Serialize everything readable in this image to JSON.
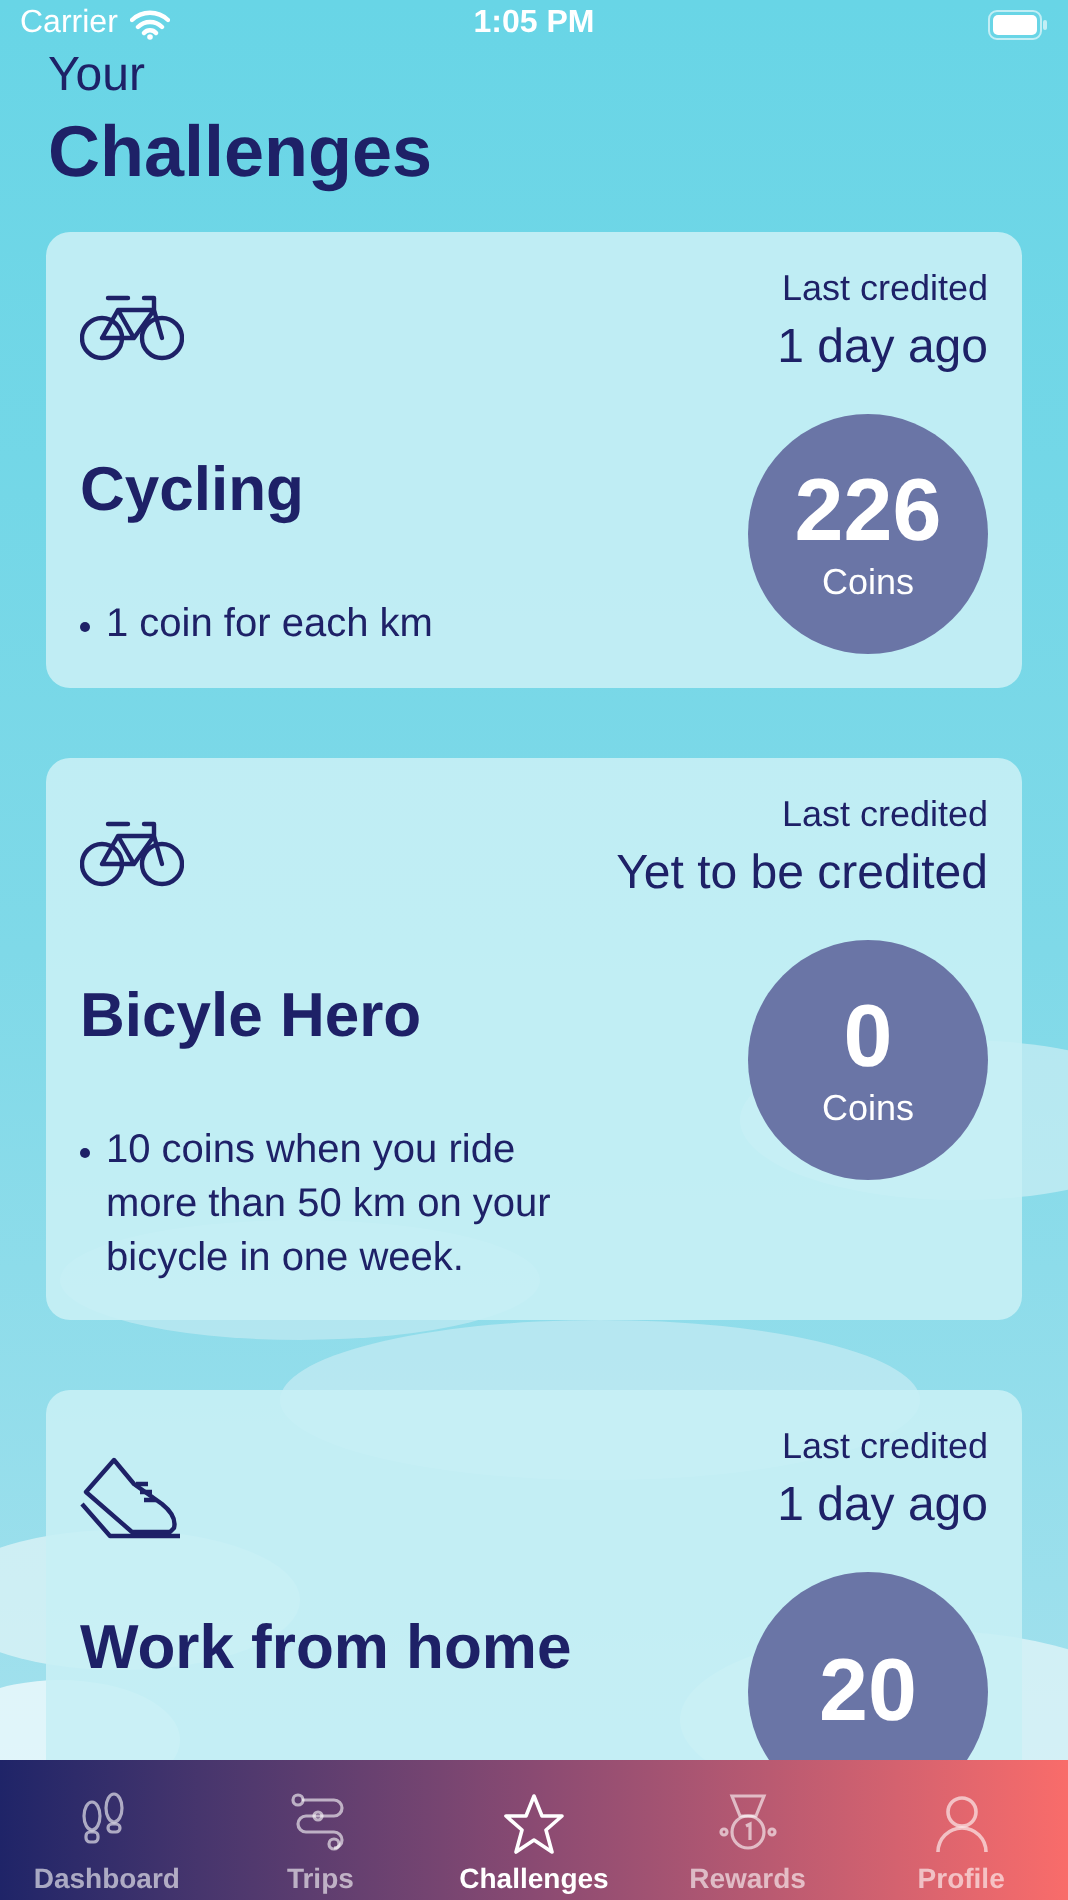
{
  "status_bar": {
    "carrier": "Carrier",
    "time": "1:05 PM"
  },
  "header": {
    "subtitle": "Your",
    "title": "Challenges"
  },
  "challenges": [
    {
      "kind": "bicycle",
      "title": "Cycling",
      "credit_label": "Last credited",
      "credit_value": "1 day ago",
      "coins": "226",
      "coins_label": "Coins",
      "rules": [
        "1 coin for each km"
      ]
    },
    {
      "kind": "bicycle",
      "title": "Bicyle Hero",
      "credit_label": "Last credited",
      "credit_value": "Yet to be credited",
      "coins": "0",
      "coins_label": "Coins",
      "rules": [
        "10 coins when you ride more than 50 km on your bicycle in one week."
      ]
    },
    {
      "kind": "shoe",
      "title": "Work from home",
      "credit_label": "Last credited",
      "credit_value": "1 day ago",
      "coins": "20"
    }
  ],
  "tab_bar": [
    {
      "kind": "footprints",
      "label": "Dashboard",
      "selected": false
    },
    {
      "kind": "route",
      "label": "Trips",
      "selected": false
    },
    {
      "kind": "star",
      "label": "Challenges",
      "selected": true
    },
    {
      "kind": "medal",
      "label": "Rewards",
      "selected": false
    },
    {
      "kind": "person",
      "label": "Profile",
      "selected": false
    }
  ]
}
